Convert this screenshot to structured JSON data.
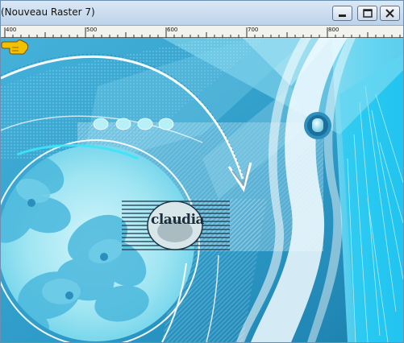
{
  "window": {
    "title": "(Nouveau Raster 7)",
    "controls": [
      "minimize",
      "maximize",
      "close"
    ]
  },
  "ruler": {
    "labels": [
      "400",
      "500",
      "600",
      "700",
      "800"
    ]
  },
  "canvas": {
    "watermark_text": "claudia",
    "dots_count": 4,
    "pointer_icon": "hand-pointing-icon",
    "colors": {
      "background": "#2e9bc8",
      "accent_light": "#a9ecf5",
      "accent_bright": "#22d8f4",
      "white_band": "#f5fbff",
      "pointer": "#f2c200"
    }
  }
}
